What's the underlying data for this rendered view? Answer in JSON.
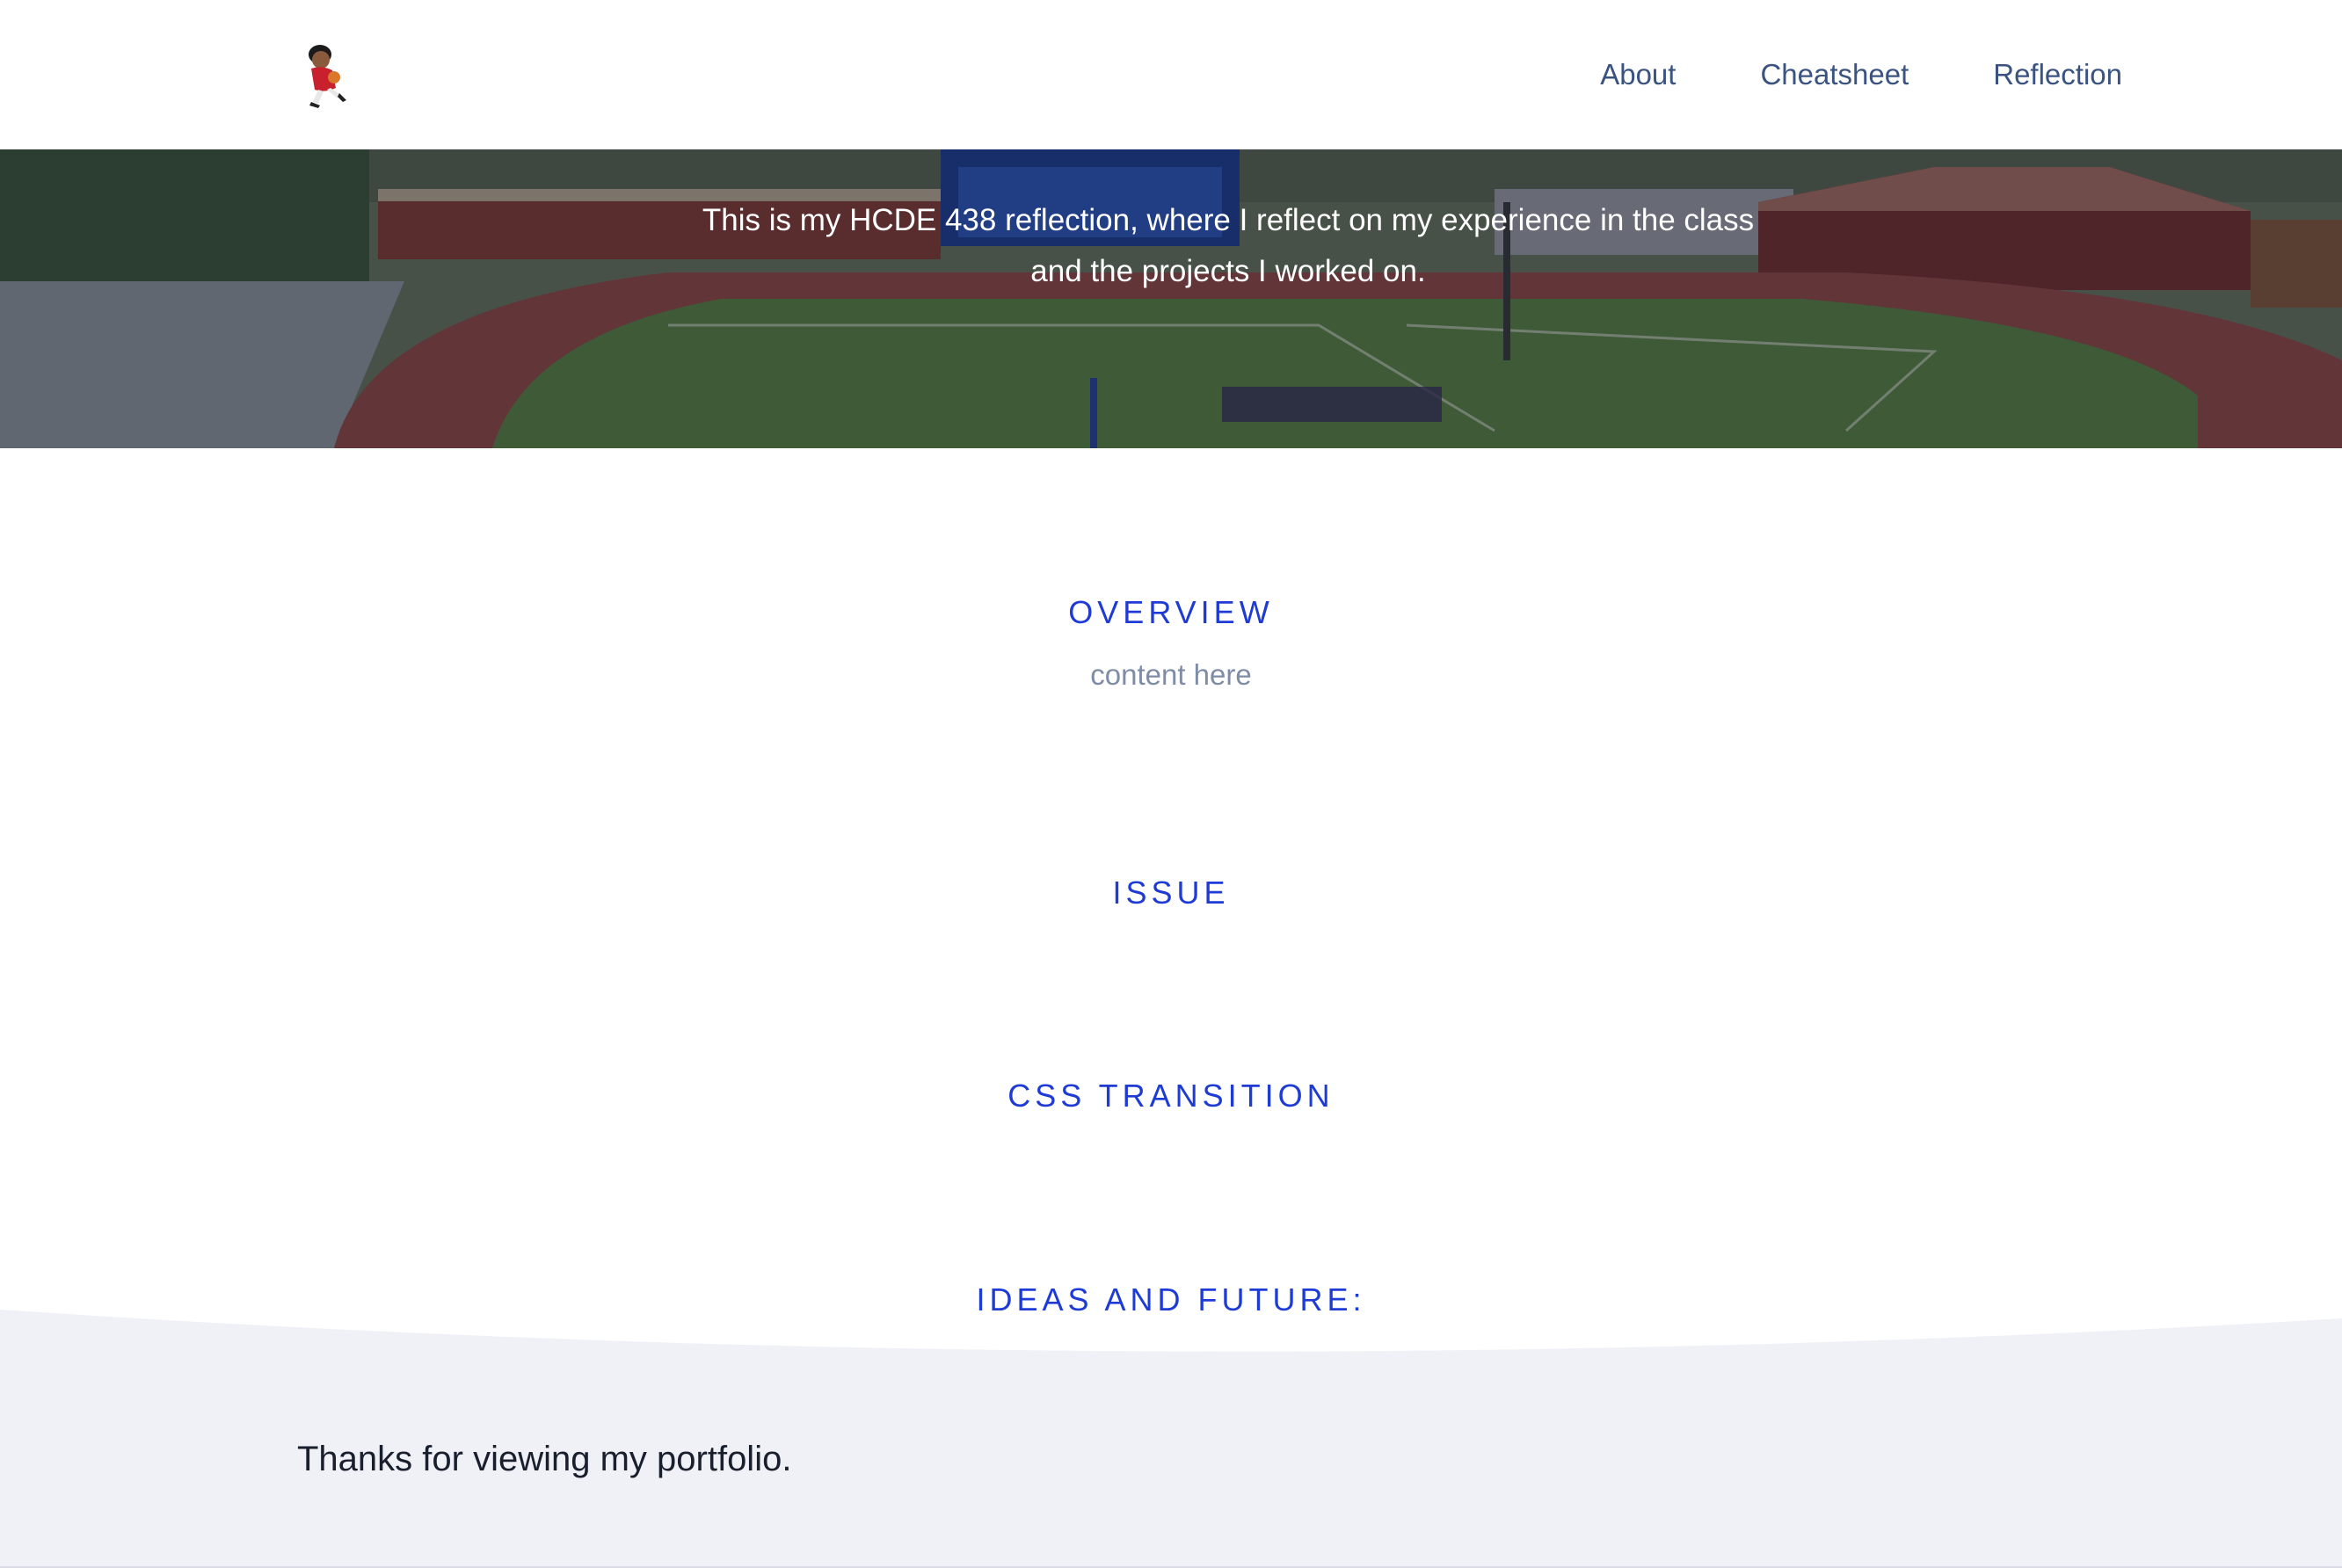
{
  "header": {
    "logo_icon": "avatar-character-icon",
    "nav": [
      {
        "label": "About"
      },
      {
        "label": "Cheatsheet"
      },
      {
        "label": "Reflection"
      }
    ]
  },
  "hero": {
    "text": "This is my HCDE 438 reflection, where I reflect on my experience in the class and the projects I worked on."
  },
  "sections": [
    {
      "heading": "OVERVIEW",
      "body": "content here"
    },
    {
      "heading": "ISSUE"
    },
    {
      "heading": "CSS TRANSITION"
    },
    {
      "heading": "IDEAS AND FUTURE:"
    }
  ],
  "footer": {
    "text": "Thanks for viewing my portfolio."
  },
  "colors": {
    "heading_accent": "#1f3bd6",
    "nav_text": "#3a5380",
    "body_muted": "#7f8ca6",
    "footer_bg": "#f0f1f6"
  }
}
